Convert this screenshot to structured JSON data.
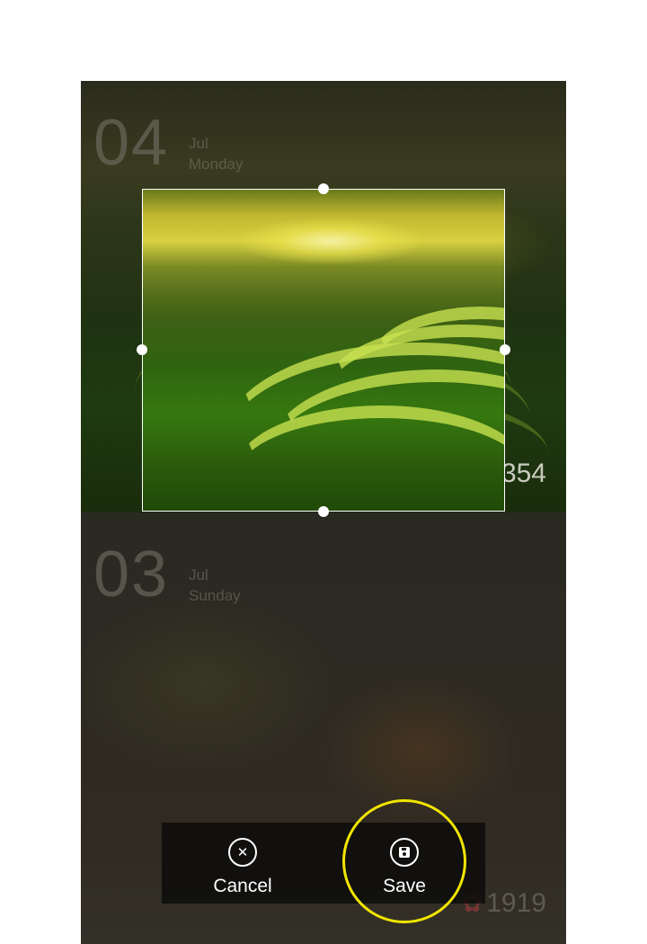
{
  "cards": [
    {
      "day": "04",
      "month": "Jul",
      "weekday": "Monday",
      "likes": "354"
    },
    {
      "day": "03",
      "month": "Jul",
      "weekday": "Sunday",
      "likes": "1919"
    }
  ],
  "icons": {
    "like": "flower-icon",
    "cancel": "close-circle-icon",
    "save": "save-floppy-icon"
  },
  "actions": {
    "cancel_label": "Cancel",
    "save_label": "Save"
  },
  "colors": {
    "highlight": "#f2e500",
    "like_icon": "#e0505a",
    "crop_border": "#ffffff"
  }
}
